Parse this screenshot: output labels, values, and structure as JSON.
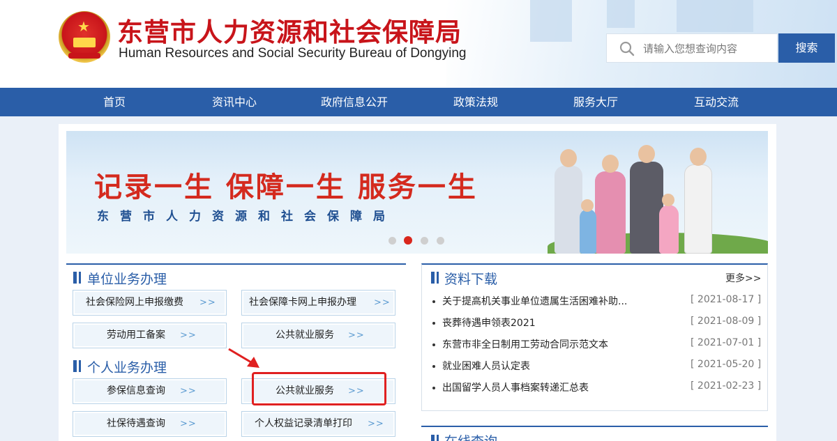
{
  "header": {
    "title_cn": "东营市人力资源和社会保障局",
    "title_en": "Human Resources and Social Security Bureau of Dongying",
    "search_placeholder": "请输入您想查询内容",
    "search_button": "搜索",
    "icons": [
      "national-emblem",
      "search-icon"
    ]
  },
  "nav": {
    "items": [
      {
        "label": "首页"
      },
      {
        "label": "资讯中心"
      },
      {
        "label": "政府信息公开"
      },
      {
        "label": "政策法规"
      },
      {
        "label": "服务大厅"
      },
      {
        "label": "互动交流"
      }
    ]
  },
  "banner": {
    "slogan": "记录一生 保障一生 服务一生",
    "subtitle": "东营市人力资源和社会保障局",
    "slide_count": 4,
    "active_slide": 2
  },
  "unit_services": {
    "title": "单位业务办理",
    "buttons": [
      {
        "label": "社会保险网上申报缴费",
        "arrow": ">>"
      },
      {
        "label": "社会保障卡网上申报办理",
        "arrow": ">>"
      },
      {
        "label": "劳动用工备案",
        "arrow": ">>"
      },
      {
        "label": "公共就业服务",
        "arrow": ">>"
      }
    ]
  },
  "personal_services": {
    "title": "个人业务办理",
    "buttons": [
      {
        "label": "参保信息查询",
        "arrow": ">>"
      },
      {
        "label": "公共就业服务",
        "arrow": ">>"
      },
      {
        "label": "社保待遇查询",
        "arrow": ">>"
      },
      {
        "label": "个人权益记录清单打印",
        "arrow": ">>"
      }
    ]
  },
  "downloads": {
    "title": "资料下载",
    "more": "更多>>",
    "items": [
      {
        "title": "关于提高机关事业单位遗属生活困难补助...",
        "date": "[ 2021-08-17 ]"
      },
      {
        "title": "丧葬待遇申领表2021",
        "date": "[ 2021-08-09 ]"
      },
      {
        "title": "东营市非全日制用工劳动合同示范文本",
        "date": "[ 2021-07-01 ]"
      },
      {
        "title": "就业困难人员认定表",
        "date": "[ 2021-05-20 ]"
      },
      {
        "title": "出国留学人员人事档案转递汇总表",
        "date": "[ 2021-02-23 ]"
      }
    ]
  },
  "online_query": {
    "title": "在线查询"
  },
  "colors": {
    "brand_blue": "#2a5ea8",
    "title_red": "#c8141a",
    "highlight_red": "#e02020",
    "page_bg": "#eaf0f8"
  }
}
